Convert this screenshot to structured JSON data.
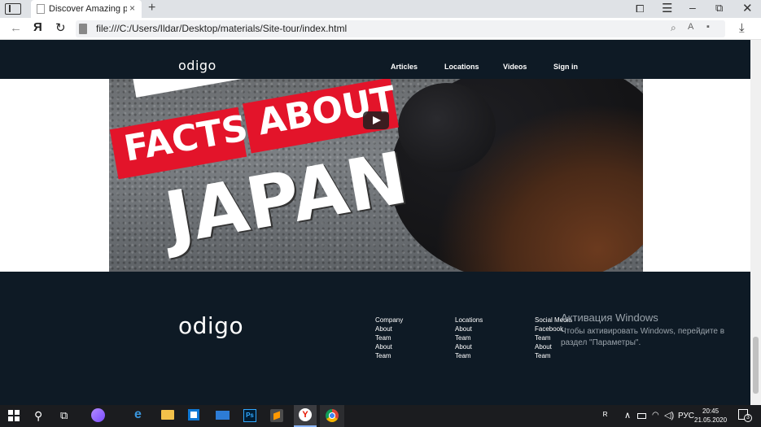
{
  "browser": {
    "tab_title": "Discover Amazing places",
    "tab_close": "×",
    "new_tab": "+",
    "url": "file:///C:/Users/Ildar/Desktop/materials/Site-tour/index.html",
    "icons": {
      "sidebar": "sidebar-icon",
      "reading_list": "reading-list-icon",
      "menu": "☰",
      "minimize": "–",
      "restore": "⧉",
      "close": "✕",
      "back": "←",
      "yandex": "Я",
      "reload": "↻",
      "search_page": "⌕",
      "translate": "A",
      "bookmark": "▪",
      "download": "⤓"
    }
  },
  "site": {
    "logo": "odigo",
    "nav": [
      "Articles",
      "Locations",
      "Videos",
      "Sign in"
    ],
    "video": {
      "words": [
        "FACTS",
        "ABOUT",
        "JAPAN"
      ],
      "colors": {
        "banner": "#e3142a"
      }
    },
    "footer": {
      "logo": "odigo",
      "columns": [
        {
          "heading": "Company",
          "items": [
            "About",
            "Team",
            "About",
            "Team"
          ]
        },
        {
          "heading": "Locations",
          "items": [
            "About",
            "Team",
            "About",
            "Team"
          ]
        },
        {
          "heading": "Social Media",
          "items": [
            "Facebook",
            "Team",
            "About",
            "Team"
          ]
        }
      ]
    },
    "colors": {
      "dark": "#0e1a25"
    }
  },
  "windows_activation": {
    "title": "Активация Windows",
    "text": "Чтобы активировать Windows, перейдите в раздел \"Параметры\"."
  },
  "taskbar": {
    "search": "⚲",
    "task_view": "⧉",
    "ps_label": "Ps",
    "yandex_label": "Y",
    "tray": {
      "people": "ᴿ",
      "chevron": "∧",
      "wifi": "◠",
      "volume": "◁)",
      "language": "РУС"
    },
    "time": "20:45",
    "date": "21.05.2020",
    "notification_count": "3"
  }
}
